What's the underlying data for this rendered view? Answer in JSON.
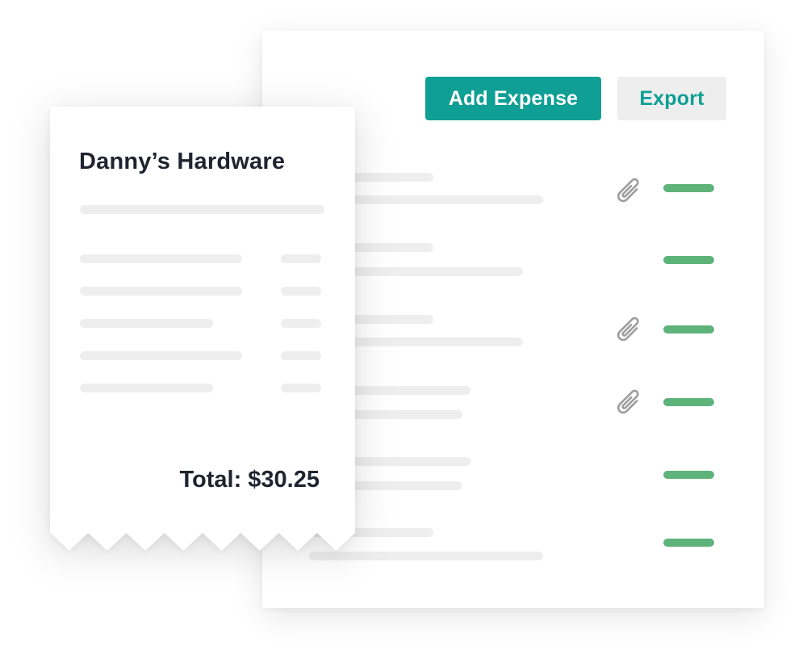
{
  "expense_panel": {
    "add_expense_label": "Add Expense",
    "export_label": "Export",
    "rows": [
      {
        "attachment": true,
        "status_color": "#5db37a"
      },
      {
        "attachment": false,
        "status_color": "#5db37a"
      },
      {
        "attachment": true,
        "status_color": "#5db37a"
      },
      {
        "attachment": true,
        "status_color": "#5db37a"
      },
      {
        "attachment": false,
        "status_color": "#5db37a"
      },
      {
        "attachment": false,
        "status_color": "#5db37a"
      }
    ]
  },
  "receipt": {
    "merchant": "Danny’s Hardware",
    "total": "Total: $30.25",
    "line_item_count": 5
  },
  "colors": {
    "accent": "#0f9f94",
    "status_green": "#5db37a",
    "placeholder_bar": "#eeeeee",
    "text_dark": "#1f2430"
  },
  "icons": {
    "attachment": "paperclip-icon"
  }
}
